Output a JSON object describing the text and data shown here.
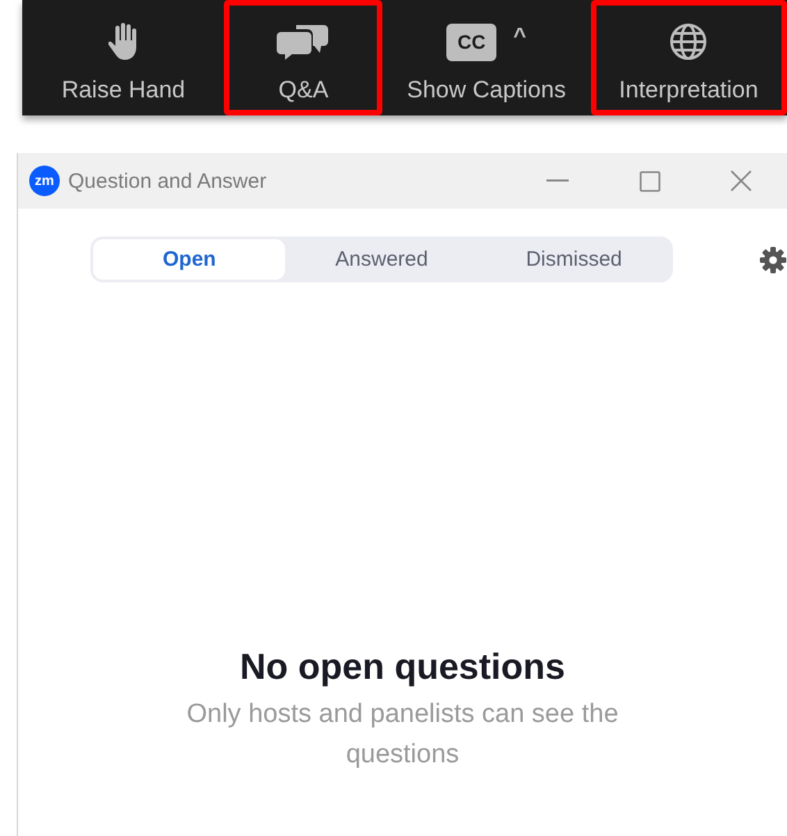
{
  "toolbar": {
    "buttons": [
      {
        "kind": "hand",
        "label": "Raise Hand",
        "highlighted": false
      },
      {
        "kind": "chat",
        "label": "Q&A",
        "highlighted": true
      },
      {
        "kind": "captions",
        "label": "Show Captions",
        "badge": "CC",
        "caret": "^",
        "highlighted": false
      },
      {
        "kind": "globe",
        "label": "Interpretation",
        "highlighted": true
      }
    ]
  },
  "window": {
    "app_badge": "zm",
    "title": "Question and Answer"
  },
  "tabs": [
    {
      "label": "Open",
      "selected": true
    },
    {
      "label": "Answered",
      "selected": false
    },
    {
      "label": "Dismissed",
      "selected": false
    }
  ],
  "empty_state": {
    "heading": "No open questions",
    "message": "Only hosts and panelists can see the questions"
  }
}
